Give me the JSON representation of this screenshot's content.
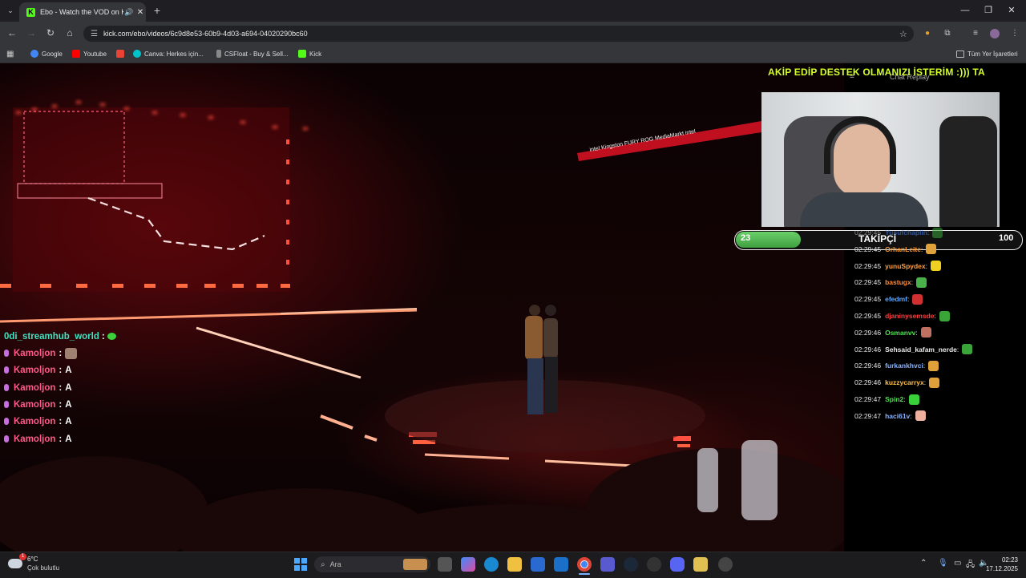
{
  "browser": {
    "tab_title": "Ebo - Watch the VOD on Ki",
    "tab_favicon": "K",
    "url": "kick.com/ebo/videos/6c9d8e53-60b9-4d03-a694-04020290bc60",
    "bookmarks": [
      {
        "label": "Google",
        "icon": "google-icon",
        "color": "#4285f4"
      },
      {
        "label": "Youtube",
        "icon": "youtube-icon",
        "color": "#ff0000"
      },
      {
        "label": "",
        "icon": "gmail-icon",
        "color": "#ea4335"
      },
      {
        "label": "Canva: Herkes için...",
        "icon": "canva-icon",
        "color": "#00c4cc"
      },
      {
        "label": "CSFloat - Buy & Sell...",
        "icon": "csfloat-icon",
        "color": "#888888"
      },
      {
        "label": "Kick",
        "icon": "kick-icon",
        "color": "#53fc18"
      }
    ],
    "all_bookmarks": "Tüm Yer İşaretleri"
  },
  "overlay": {
    "marquee": "AKİP EDİP DESTEK OLMANIZI İSTERİM :))) TA",
    "chat_replay": "Chat Replay",
    "goal_current": "23",
    "goal_label": "TAKİPÇİ",
    "goal_max": "100",
    "goal_fraction": 0.23
  },
  "chat": [
    {
      "time": "02:29:45",
      "user": "Yusufchaplin",
      "color": "#4a8cff",
      "emote": "#3aa63a"
    },
    {
      "time": "02:29:45",
      "user": "OrhanLeite",
      "color": "#ff9a2e",
      "emote": "#e0a03a"
    },
    {
      "time": "02:29:45",
      "user": "yunuSpydex",
      "color": "#ffa040",
      "emote": "#f0d020"
    },
    {
      "time": "02:29:45",
      "user": "bastugx",
      "color": "#ff8c3a",
      "emote": "#4ab04a"
    },
    {
      "time": "02:29:45",
      "user": "efedmf",
      "color": "#5aa8ff",
      "emote": "#d03030"
    },
    {
      "time": "02:29:45",
      "user": "djaninysemsde",
      "color": "#ff3d3d",
      "emote": "#3aa63a"
    },
    {
      "time": "02:29:46",
      "user": "Osmanvv",
      "color": "#52e052",
      "emote": "#c07060"
    },
    {
      "time": "02:29:46",
      "user": "Sehsaid_kafam_nerde",
      "color": "#e8e8e8",
      "emote": "#3aa63a"
    },
    {
      "time": "02:29:46",
      "user": "furkankhvci",
      "color": "#8ab4ff",
      "emote": "#e0a03a"
    },
    {
      "time": "02:29:46",
      "user": "kuzzycarryx",
      "color": "#ffc040",
      "emote": "#e0a03a"
    },
    {
      "time": "02:29:47",
      "user": "Spin2",
      "color": "#52e052",
      "emote": "#3ad03a"
    },
    {
      "time": "02:29:47",
      "user": "haci61v",
      "color": "#8ab4ff",
      "emote": "#f0b0a0"
    }
  ],
  "left_chat": {
    "header_user": "0di_streamhub_world",
    "header_color": "#40e0c0",
    "messages": [
      {
        "user": "Kamoljon",
        "text": ""
      },
      {
        "user": "Kamoljon",
        "text": "A"
      },
      {
        "user": "Kamoljon",
        "text": "A"
      },
      {
        "user": "Kamoljon",
        "text": "A"
      },
      {
        "user": "Kamoljon",
        "text": "A"
      },
      {
        "user": "Kamoljon",
        "text": "A"
      }
    ],
    "user_color": "#ff5a8a"
  },
  "taskbar": {
    "temp": "6°C",
    "weather": "Çok bulutlu",
    "weather_badge": "1",
    "search": "Ara",
    "time": "02:23",
    "date": "17.12.2025"
  },
  "stage_text": {
    "banner": "intel   Kingston   FURY   ROG   MediaMarkt   intel"
  }
}
